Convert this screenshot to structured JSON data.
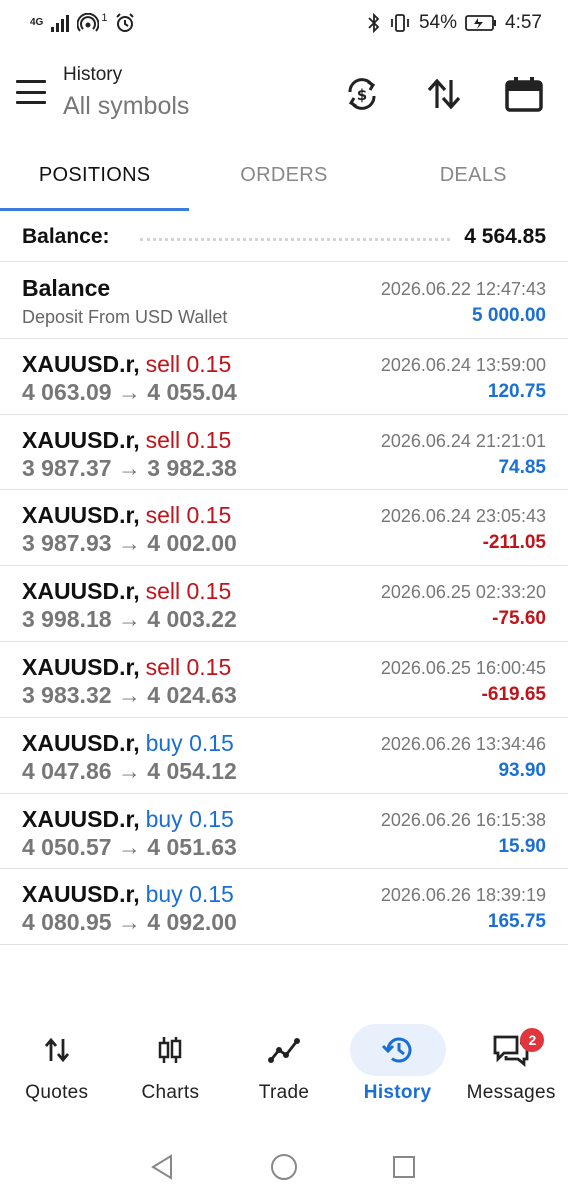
{
  "status_bar": {
    "network": "4G",
    "notification_count": "1",
    "battery": "54%",
    "time": "4:57"
  },
  "header": {
    "title": "History",
    "subtitle": "All symbols"
  },
  "tabs": [
    {
      "label": "POSITIONS",
      "active": true
    },
    {
      "label": "ORDERS",
      "active": false
    },
    {
      "label": "DEALS",
      "active": false
    }
  ],
  "balance_summary": {
    "label": "Balance:",
    "value": "4 564.85"
  },
  "deposit": {
    "title": "Balance",
    "description": "Deposit From USD Wallet",
    "time": "2026.06.22 12:47:43",
    "amount": "5 000.00"
  },
  "positions": [
    {
      "symbol": "XAUUSD.r,",
      "type": "sell 0.15",
      "side": "sell",
      "prices": "4 063.09 → 4 055.04",
      "time": "2026.06.24 13:59:00",
      "profit": "120.75",
      "sign": "pos"
    },
    {
      "symbol": "XAUUSD.r,",
      "type": "sell 0.15",
      "side": "sell",
      "prices": "3 987.37 → 3 982.38",
      "time": "2026.06.24 21:21:01",
      "profit": "74.85",
      "sign": "pos"
    },
    {
      "symbol": "XAUUSD.r,",
      "type": "sell 0.15",
      "side": "sell",
      "prices": "3 987.93 → 4 002.00",
      "time": "2026.06.24 23:05:43",
      "profit": "-211.05",
      "sign": "neg"
    },
    {
      "symbol": "XAUUSD.r,",
      "type": "sell 0.15",
      "side": "sell",
      "prices": "3 998.18 → 4 003.22",
      "time": "2026.06.25 02:33:20",
      "profit": "-75.60",
      "sign": "neg"
    },
    {
      "symbol": "XAUUSD.r,",
      "type": "sell 0.15",
      "side": "sell",
      "prices": "3 983.32 → 4 024.63",
      "time": "2026.06.25 16:00:45",
      "profit": "-619.65",
      "sign": "neg"
    },
    {
      "symbol": "XAUUSD.r,",
      "type": "buy 0.15",
      "side": "buy",
      "prices": "4 047.86 → 4 054.12",
      "time": "2026.06.26 13:34:46",
      "profit": "93.90",
      "sign": "pos"
    },
    {
      "symbol": "XAUUSD.r,",
      "type": "buy 0.15",
      "side": "buy",
      "prices": "4 050.57 → 4 051.63",
      "time": "2026.06.26 16:15:38",
      "profit": "15.90",
      "sign": "pos"
    },
    {
      "symbol": "XAUUSD.r,",
      "type": "buy 0.15",
      "side": "buy",
      "prices": "4 080.95 → 4 092.00",
      "time": "2026.06.26 18:39:19",
      "profit": "165.75",
      "sign": "pos"
    }
  ],
  "bottom_nav": [
    {
      "label": "Quotes",
      "icon": "quotes-icon",
      "active": false
    },
    {
      "label": "Charts",
      "icon": "charts-icon",
      "active": false
    },
    {
      "label": "Trade",
      "icon": "trade-icon",
      "active": false
    },
    {
      "label": "History",
      "icon": "history-icon",
      "active": true
    },
    {
      "label": "Messages",
      "icon": "messages-icon",
      "active": false,
      "badge": "2"
    }
  ],
  "colors": {
    "accent": "#1a6fd6",
    "sell": "#c0141a",
    "loss": "#c0141a",
    "tab_indicator": "#3a7be0",
    "badge": "#e0373e"
  }
}
